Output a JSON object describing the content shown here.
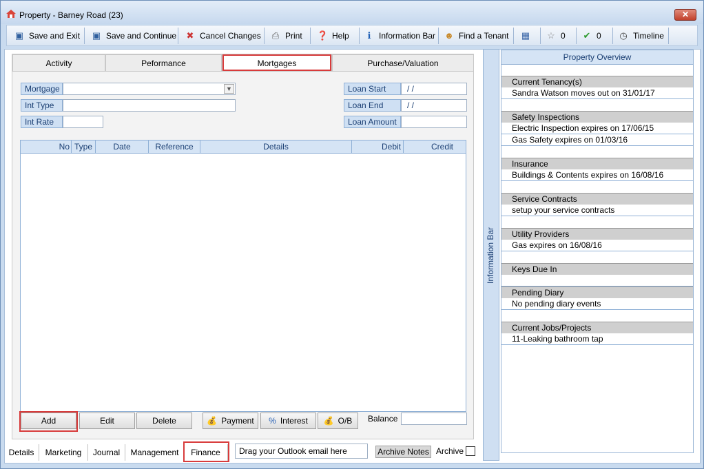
{
  "window": {
    "title": "Property  - Barney Road (23)",
    "close_label": "✕"
  },
  "toolbar": {
    "save_exit": "Save and Exit",
    "save_continue": "Save and Continue",
    "cancel": "Cancel Changes",
    "print": "Print",
    "help": "Help",
    "info_bar": "Information Bar",
    "find_tenant": "Find a Tenant",
    "star_count": "0",
    "check_count": "0",
    "timeline": "Timeline"
  },
  "tabs": [
    "Activity",
    "Peformance",
    "Mortgages",
    "Purchase/Valuation"
  ],
  "form": {
    "mortgage_label": "Mortgage",
    "mortgage_value": "",
    "int_type_label": "Int Type",
    "int_rate_label": "Int Rate",
    "loan_start_label": "Loan Start",
    "loan_start_value": "/ /",
    "loan_end_label": "Loan End",
    "loan_end_value": "/ /",
    "loan_amount_label": "Loan Amount"
  },
  "grid": {
    "columns": [
      "No",
      "Type",
      "Date",
      "Reference",
      "Details",
      "Debit",
      "Credit"
    ]
  },
  "actions": {
    "add": "Add",
    "edit": "Edit",
    "delete": "Delete",
    "payment": "Payment",
    "interest": "Interest",
    "ob": "O/B",
    "balance_label": "Balance"
  },
  "bottom_tabs": [
    "Details",
    "Marketing",
    "Journal",
    "Management",
    "Finance"
  ],
  "drag_placeholder": "Drag your Outlook email here",
  "archive_notes": "Archive Notes",
  "archive_label": "Archive",
  "info_bar_label": "Information Bar",
  "overview": {
    "title": "Property Overview",
    "sections": [
      {
        "head": "Current Tenancy(s)",
        "item": "Sandra Watson moves out on 31/01/17"
      },
      {
        "head": "Safety Inspections",
        "item": "Electric Inspection expires on 17/06/15",
        "item2": "Gas Safety expires on 01/03/16"
      },
      {
        "head": "Insurance",
        "item": "Buildings & Contents expires on 16/08/16"
      },
      {
        "head": "Service Contracts",
        "item": "setup your service contracts"
      },
      {
        "head": "Utility Providers",
        "item": "Gas expires on 16/08/16"
      },
      {
        "head": "Keys Due In",
        "item": ""
      },
      {
        "head": "Pending Diary",
        "item": "No pending diary events"
      },
      {
        "head": "Current Jobs/Projects",
        "item": "11-Leaking bathroom tap"
      }
    ]
  }
}
